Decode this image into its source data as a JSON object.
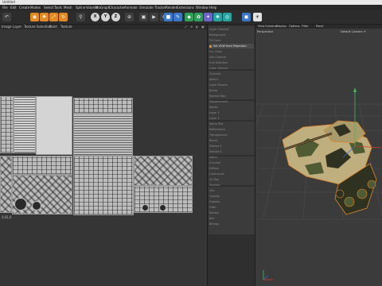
{
  "app": {
    "title": "Untitled"
  },
  "menu": [
    "File",
    "Edit",
    "Create",
    "Modes",
    "Select",
    "Tools",
    "Mesh",
    "Spline",
    "Volume",
    "MoGraph",
    "Character",
    "Animate",
    "Simulate",
    "Tracker",
    "Render",
    "Extensions",
    "Window",
    "Help"
  ],
  "toolbar": {
    "buttons": [
      {
        "icon": "undo-icon",
        "glyph": "↶",
        "style": "dark"
      },
      {
        "icon": "live-selection-icon",
        "glyph": "◉",
        "style": "orange"
      },
      {
        "icon": "move-icon",
        "glyph": "✥",
        "style": "orange"
      },
      {
        "icon": "scale-icon",
        "glyph": "⤢",
        "style": "orange"
      },
      {
        "icon": "rotate-icon",
        "glyph": "↻",
        "style": "orange"
      },
      {
        "icon": "recent-tool-icon",
        "glyph": "⚲",
        "style": "dark"
      },
      {
        "icon": "axis-x-icon",
        "glyph": "X",
        "style": "xyz"
      },
      {
        "icon": "axis-y-icon",
        "glyph": "Y",
        "style": "xyz"
      },
      {
        "icon": "axis-z-icon",
        "glyph": "Z",
        "style": "xyz"
      },
      {
        "icon": "coordinate-system-icon",
        "glyph": "⊕",
        "style": "dark"
      },
      {
        "icon": "render-view-icon",
        "glyph": "▣",
        "style": "dark"
      },
      {
        "icon": "render-picture-viewer-icon",
        "glyph": "▶",
        "style": "dark"
      },
      {
        "icon": "render-settings-icon",
        "glyph": "⚙",
        "style": "dark"
      },
      {
        "icon": "cube-icon",
        "glyph": "■",
        "style": "blue"
      },
      {
        "icon": "pen-icon",
        "glyph": "✎",
        "style": "blue"
      },
      {
        "icon": "subdivision-icon",
        "glyph": "◆",
        "style": "green"
      },
      {
        "icon": "cloner-icon",
        "glyph": "✿",
        "style": "green"
      },
      {
        "icon": "deformer-icon",
        "glyph": "✦",
        "style": "violet"
      },
      {
        "icon": "scene-icon",
        "glyph": "❖",
        "style": "teal"
      },
      {
        "icon": "field-icon",
        "glyph": "◎",
        "style": "teal"
      },
      {
        "icon": "camera-icon",
        "glyph": "◼",
        "style": "blue"
      },
      {
        "icon": "light-icon",
        "glyph": "☀",
        "style": "light"
      }
    ]
  },
  "uv_editor": {
    "tabs": [
      "Image",
      "Layer",
      "Texture Selection",
      "Paint",
      "Texture"
    ],
    "controls": [
      "⤢",
      "⊕",
      "◐",
      "▣"
    ],
    "coord_labels": [
      "0,0",
      "1,0"
    ]
  },
  "layers_panel": {
    "items": [
      "Layer Channel",
      "Background",
      "Fill Color",
      "Set UVW from Projection",
      "Lin. Hues",
      "Use Channel",
      "Hue Selection",
      "Layer Options",
      "Channel",
      "Attach",
      "Layer Params",
      "Bump",
      "Normal Map",
      "Displacement",
      "Nodes",
      "Layer 1",
      "Layer 2",
      "Alpha Test",
      "Reflectance",
      "Transparency",
      "Blend",
      "Texture 1",
      "Texture 2",
      "Alpha",
      "Channel",
      "Diffuse",
      "Luminance",
      "UV Tag",
      "Shadow",
      "Clip",
      "Opacity",
      "Gamma",
      "Filter",
      "Normal",
      "Blur",
      "Bitmap"
    ],
    "selected_index": 3
  },
  "viewport": {
    "menu": [
      "View",
      "Cameras",
      "Display",
      "Options",
      "Filter",
      "Panel"
    ],
    "view_name": "Perspective",
    "camera": "Default Camera ☀",
    "colors": {
      "camo_tan": "#bfae7e",
      "camo_green": "#4f5b32",
      "camo_dark": "#2f3221",
      "selection_orange": "#e0882a",
      "axis_x": "#d43a2a",
      "axis_y": "#3fbf5a",
      "axis_z": "#3a6ad4"
    }
  }
}
